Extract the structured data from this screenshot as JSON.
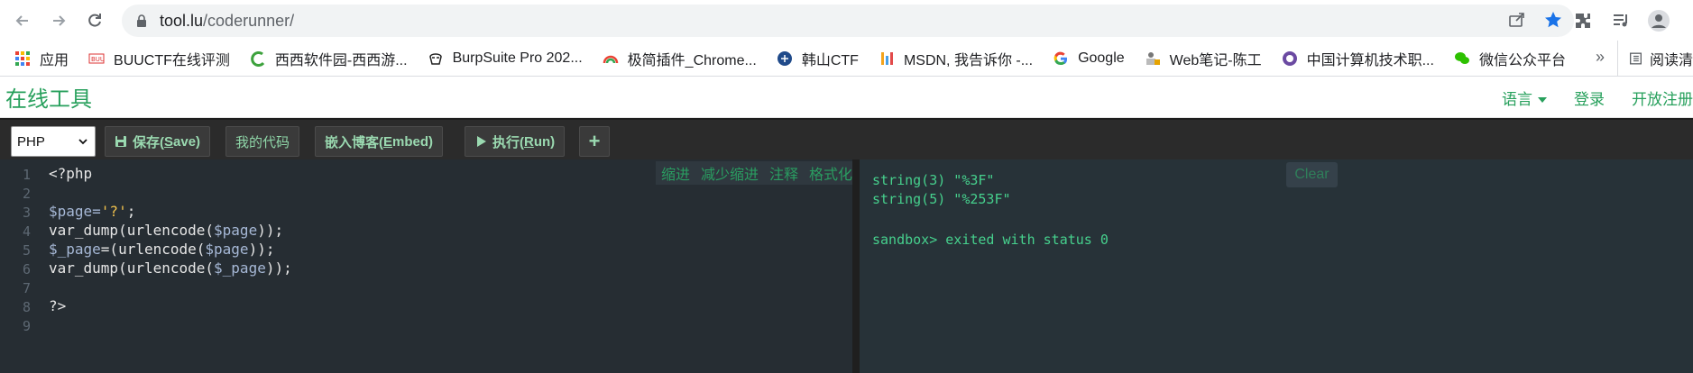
{
  "browser": {
    "url_host": "tool.lu",
    "url_path": "/coderunner/",
    "bookmarks": [
      {
        "label": "应用",
        "icon": "apps-grid-icon"
      },
      {
        "label": "BUUCTF在线评测",
        "icon": "buuctf-icon"
      },
      {
        "label": "西西软件园-西西游...",
        "icon": "cr173-icon"
      },
      {
        "label": "BurpSuite Pro 202...",
        "icon": "hacker-icon"
      },
      {
        "label": "极简插件_Chrome...",
        "icon": "rainbow-icon"
      },
      {
        "label": "韩山CTF",
        "icon": "badge-icon"
      },
      {
        "label": "MSDN, 我告诉你 -...",
        "icon": "msdn-icon"
      },
      {
        "label": "Google",
        "icon": "google-icon"
      },
      {
        "label": "Web笔记-陈工",
        "icon": "lock-person-icon"
      },
      {
        "label": "中国计算机技术职...",
        "icon": "circle-logo-icon"
      },
      {
        "label": "微信公众平台",
        "icon": "wechat-icon"
      }
    ],
    "bookmarks_more": "»",
    "reading_list": "阅读清"
  },
  "site": {
    "logo": "在线工具",
    "nav": {
      "language": "语言",
      "login": "登录",
      "register": "开放注册"
    }
  },
  "toolbar": {
    "language": "PHP",
    "save_prefix": "保存(",
    "save_key": "S",
    "save_suffix": "ave)",
    "my_code": "我的代码",
    "embed_prefix": "嵌入博客(",
    "embed_key": "E",
    "embed_suffix": "mbed)",
    "run_prefix": "执行(",
    "run_key": "R",
    "run_suffix": "un)",
    "add": "+"
  },
  "editor": {
    "actions": [
      "缩进",
      "减少缩进",
      "注释",
      "格式化"
    ],
    "line_numbers": [
      "1",
      "2",
      "3",
      "4",
      "5",
      "6",
      "7",
      "8",
      "9"
    ],
    "lines": {
      "l1": "<?php",
      "l3a": "$page=",
      "l3b": "'?'",
      "l3c": ";",
      "l4a": "var_dump(urlencode(",
      "l4b": "$page",
      "l4c": "));",
      "l5a": "$_page",
      "l5b": "=(urlencode(",
      "l5c": "$page",
      "l5d": "));",
      "l6a": "var_dump(urlencode(",
      "l6b": "$_page",
      "l6c": "));",
      "l8": "?>"
    }
  },
  "output": {
    "clear": "Clear",
    "lines": [
      "string(3) \"%3F\"",
      "string(5) \"%253F\"",
      "sandbox> exited with status 0"
    ]
  },
  "colors": {
    "brand_green": "#27a05c",
    "editor_bg": "#262d33",
    "output_text": "#46d08d"
  }
}
